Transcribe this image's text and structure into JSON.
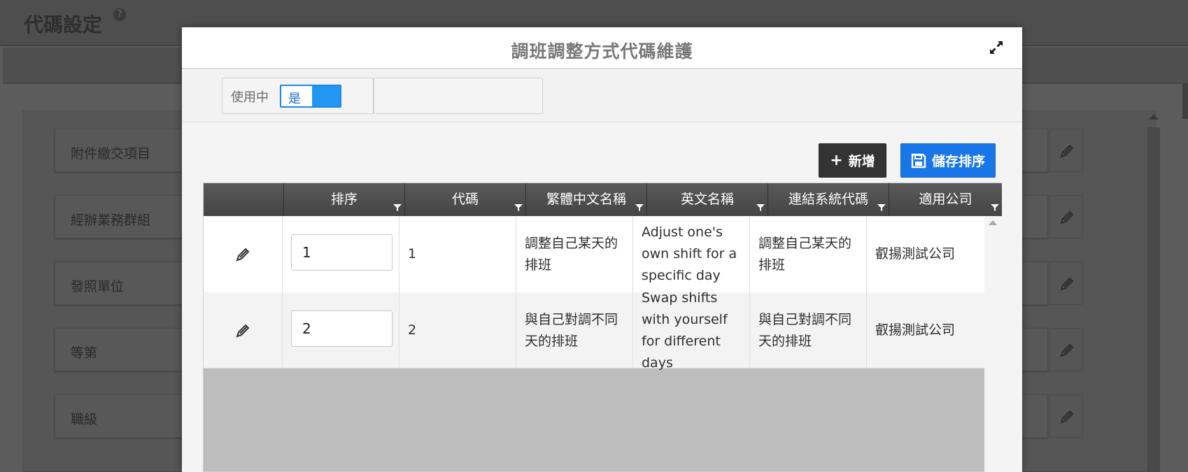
{
  "background": {
    "page_title": "代碼設定",
    "help_icon": "?",
    "items": [
      {
        "label": "附件繳交項目"
      },
      {
        "label": "經辦業務群組"
      },
      {
        "label": "發照單位"
      },
      {
        "label": "等第"
      },
      {
        "label": "職級"
      }
    ]
  },
  "modal": {
    "title": "調班調整方式代碼維護",
    "filter": {
      "label": "使用中",
      "toggle_value": "是"
    },
    "buttons": {
      "add_label": "新增",
      "add_icon": "+",
      "save_label": "儲存排序"
    },
    "table": {
      "columns": [
        "排序",
        "代碼",
        "繁體中文名稱",
        "英文名稱",
        "連結系統代碼",
        "適用公司"
      ],
      "rows": [
        {
          "sort": "1",
          "code": "1",
          "zh_name": "調整自己某天的排班",
          "en_name": "Adjust one's own shift for a specific day",
          "link_code": "調整自己某天的排班",
          "company": "叡揚測試公司"
        },
        {
          "sort": "2",
          "code": "2",
          "zh_name": "與自己對調不同天的排班",
          "en_name": "Swap shifts with yourself for different days",
          "link_code": "與自己對調不同天的排班",
          "company": "叡揚測試公司"
        }
      ]
    }
  },
  "colors": {
    "primary": "#1976e8",
    "dark_button": "#333333",
    "header": "#4a4a4a"
  }
}
